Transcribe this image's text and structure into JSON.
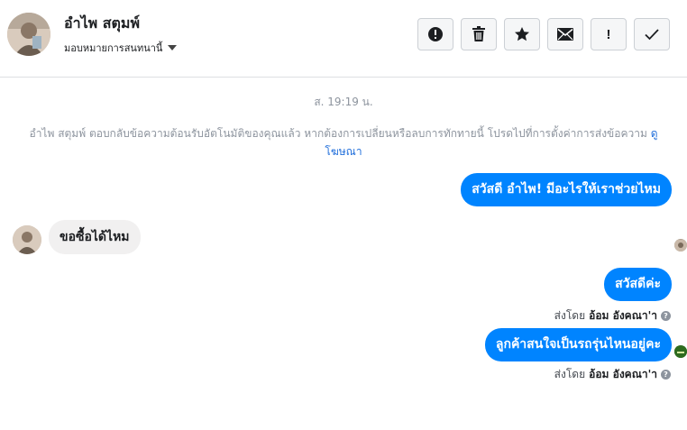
{
  "header": {
    "contact_name": "อำไพ สตุมพ์",
    "assign_label": "มอบหมายการสนทนานี้",
    "actions": [
      {
        "name": "spam",
        "icon": "alert-circle-icon",
        "label": ""
      },
      {
        "name": "delete",
        "icon": "trash-icon",
        "label": ""
      },
      {
        "name": "star",
        "icon": "star-icon",
        "label": ""
      },
      {
        "name": "unread",
        "icon": "envelope-icon",
        "label": ""
      },
      {
        "name": "follow-up",
        "icon": "exclamation-icon",
        "label": "!"
      },
      {
        "name": "done",
        "icon": "checkmark-icon",
        "label": ""
      }
    ]
  },
  "conversation": {
    "timestamp": "ส. 19:19 น.",
    "system_message": "อำไพ สตุมพ์ ตอบกลับข้อความต้อนรับอัตโนมัติของคุณแล้ว หากต้องการเปลี่ยนหรือลบการทักทายนี้ โปรดไปที่การตั้งค่าการส่งข้อความ",
    "system_link": "ดูโฆษณา",
    "messages": [
      {
        "direction": "outgoing",
        "text": "สวัสดี อำไพ! มีอะไรให้เราช่วยไหม"
      },
      {
        "direction": "incoming",
        "text": "ขอซื้อได้ไหม"
      },
      {
        "direction": "outgoing",
        "text": "สวัสดีค่ะ"
      },
      {
        "direction": "outgoing",
        "text": "ลูกค้าสนใจเป็นรถรุ่นไหนอยู่คะ"
      }
    ],
    "sent_by": [
      {
        "prefix": "ส่งโดย",
        "name": "อ้อม อังคณา'า"
      },
      {
        "prefix": "ส่งโดย",
        "name": "อ้อม อังคณา'า"
      }
    ]
  },
  "colors": {
    "outgoing_bubble": "#0084ff",
    "incoming_bubble": "#f1f0f0",
    "link": "#216fdb",
    "muted_text": "#8d949e"
  }
}
